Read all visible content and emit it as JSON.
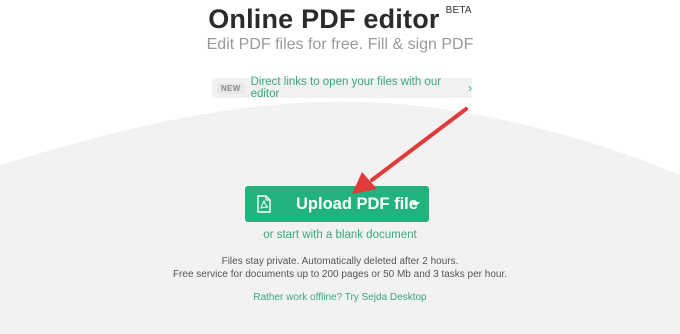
{
  "header": {
    "title": "Online PDF editor",
    "beta": "BETA",
    "subtitle": "Edit PDF files for free. Fill & sign PDF"
  },
  "news": {
    "badge": "NEW",
    "text": "Direct links to open your files with our editor",
    "chevron": "›"
  },
  "upload": {
    "label": "Upload PDF file",
    "icon": "pdf-file-icon",
    "caret_icon": "caret-down-icon",
    "color": "#21b37c"
  },
  "blank_document": "or start with a blank document",
  "privacy": {
    "line1": "Files stay private. Automatically deleted after 2 hours.",
    "line2": "Free service for documents up to 200 pages or 50 Mb and 3 tasks per hour."
  },
  "offline_link": "Rather work offline? Try Sejda Desktop",
  "colors": {
    "accent": "#3aa87b",
    "annotation_arrow": "#e03a3a",
    "background_band": "#f2f2f2"
  }
}
